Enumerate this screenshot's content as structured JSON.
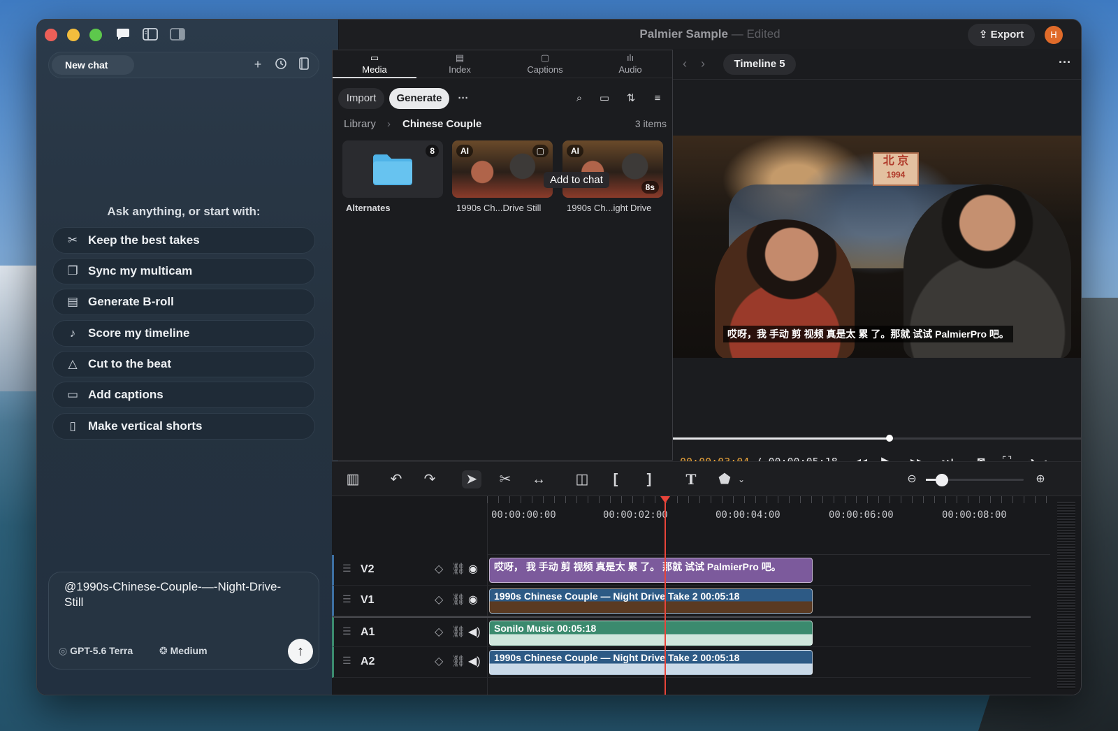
{
  "window": {
    "title": "Palmier Sample",
    "title_sep": " — ",
    "status": "Edited",
    "export_label": "Export",
    "avatar_letter": "H"
  },
  "chat": {
    "new_chat_label": "New chat",
    "prompt_heading": "Ask anything, or start with:",
    "suggestions": [
      {
        "label": "Keep the best takes",
        "icon": "scissors-icon"
      },
      {
        "label": "Sync my multicam",
        "icon": "multicam-icon"
      },
      {
        "label": "Generate B-roll",
        "icon": "film-icon"
      },
      {
        "label": "Score my timeline",
        "icon": "music-note-icon"
      },
      {
        "label": "Cut to the beat",
        "icon": "metronome-icon"
      },
      {
        "label": "Add captions",
        "icon": "captions-icon"
      },
      {
        "label": "Make vertical shorts",
        "icon": "phone-icon"
      }
    ],
    "composer_text": "@1990s-Chinese-Couple-—-Night-Drive-Still",
    "model": "GPT-5.6 Terra",
    "effort": "Medium"
  },
  "media": {
    "tabs": [
      "Media",
      "Index",
      "Captions",
      "Audio"
    ],
    "import_label": "Import",
    "generate_label": "Generate",
    "breadcrumb_root": "Library",
    "breadcrumb_current": "Chinese Couple",
    "item_count": "3 items",
    "items": [
      {
        "name": "Alternates",
        "badge": "8"
      },
      {
        "name": "1990s Ch...Drive Still",
        "badge": "AI"
      },
      {
        "name": "1990s Ch...ight Drive",
        "badge": "AI",
        "duration": "8s"
      }
    ],
    "tooltip": "Add to chat"
  },
  "preview": {
    "timeline_name": "Timeline 5",
    "subtitle": "哎呀，我 手动 剪 视频 真是太 累 了。那就 试试 PalmierPro 吧。",
    "sign_top": "北 京",
    "sign_bottom": "1994",
    "current_time": "00:00:03:04",
    "separator": " / ",
    "total_time": "00:00:05:18",
    "speed": "1×",
    "progress": 0.53
  },
  "timeline": {
    "ruler": [
      "00:00:00:00",
      "00:00:02:00",
      "00:00:04:00",
      "00:00:06:00",
      "00:00:08:00"
    ],
    "tracks": [
      {
        "name": "V2",
        "clip": "哎呀，  我 手动 剪 视频 真是太 累 了。 那就 试试 PalmierPro 吧。"
      },
      {
        "name": "V1",
        "clip": "1990s Chinese Couple — Night Drive Take 2  00:05:18"
      },
      {
        "name": "A1",
        "clip": "Sonilo Music  00:05:18"
      },
      {
        "name": "A2",
        "clip": "1990s Chinese Couple — Night Drive Take 2  00:05:18"
      }
    ]
  },
  "colors": {
    "accent_orange": "#e7a23b",
    "playhead": "#e8443a",
    "caption_clip": "#7c5a9c",
    "video_clip": "#2d5a85",
    "music_clip": "#3b8a6e"
  }
}
